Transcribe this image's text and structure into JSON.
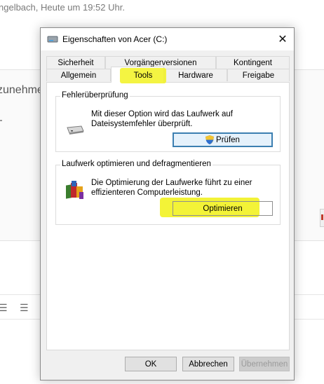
{
  "background": {
    "meta_line": "ngelbach, Heute um 19:52 Uhr.",
    "heading_fragment": "zunehme"
  },
  "dialog": {
    "title": "Eigenschaften von Acer (C:)",
    "close_icon": "close-icon",
    "tabs_row1": [
      "Sicherheit",
      "Vorgängerversionen",
      "Kontingent"
    ],
    "tabs_row2": [
      "Allgemein",
      "Tools",
      "Hardware",
      "Freigabe"
    ],
    "active_tab": "Tools",
    "error_check": {
      "group_title": "Fehlerüberprüfung",
      "description": "Mit dieser Option wird das Laufwerk auf Dateisystemfehler überprüft.",
      "button_label": "Prüfen",
      "icon": "hard-drive-icon"
    },
    "optimize": {
      "group_title": "Laufwerk optimieren und defragmentieren",
      "description": "Die Optimierung der Laufwerke führt zu einer effizienteren Computerleistung.",
      "button_label": "Optimieren",
      "icon": "defrag-icon"
    },
    "buttons": {
      "ok": "OK",
      "cancel": "Abbrechen",
      "apply": "Übernehmen"
    }
  },
  "colors": {
    "highlight": "#f2f221",
    "focus_border": "#3c7fb1",
    "dialog_bg": "#f0f0f0"
  }
}
